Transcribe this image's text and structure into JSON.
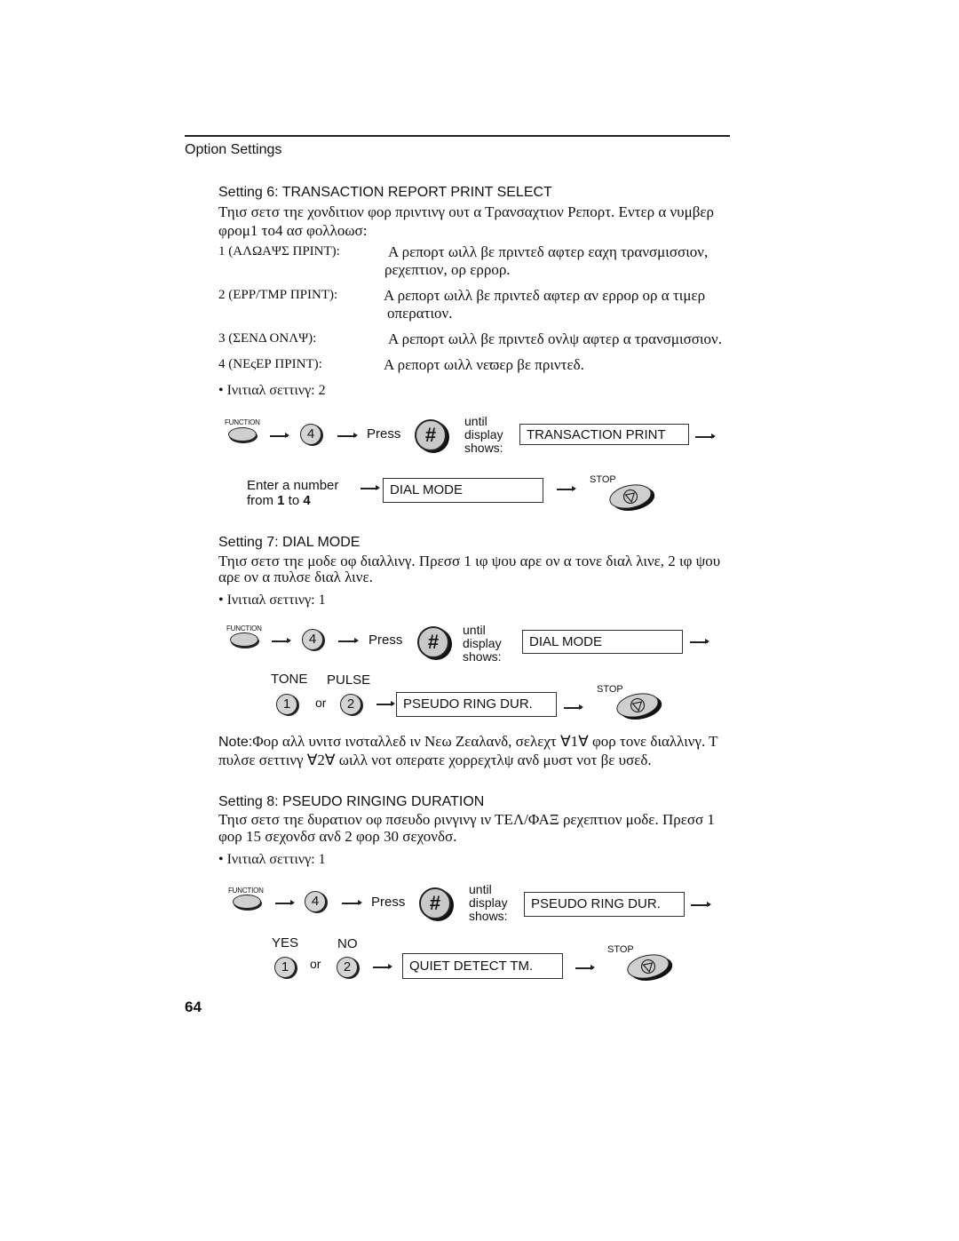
{
  "header": {
    "title": "Option Settings"
  },
  "page_number": "64",
  "setting6": {
    "heading": "Setting 6: TRANSACTION REPORT PRINT SELECT",
    "para_line1": "Τηισ σετσ τηε χονδιτιον φορ πριντινγ ουτ α Τρανσαχτιον Ρεπορτ. Εντερ α νυμβερ",
    "para_line2": "φρομ1 το4 ασ φολλοωσ:",
    "options": [
      {
        "key": "1 (ΑΛΩΑΨΣ ΠΡΙΝΤ):",
        "desc1": "Α ρεπορτ ωιλλ βε πριντεδ αφτερ εαχη τρανσμισσιον,",
        "desc2": "ρεχεπτιον, ορ ερρορ."
      },
      {
        "key": "2 (ΕΡΡ/ΤΜΡ ΠΡΙΝΤ):",
        "desc1": "Α ρεπορτ ωιλλ βε πριντεδ αφτερ αν ερρορ ορ α τιμερ",
        "desc2": "οπερατιον."
      },
      {
        "key": "3 (ΣΕΝΔ ΟΝΛΨ):",
        "desc1": "Α ρεπορτ ωιλλ βε πριντεδ ονλψ αφτερ α τρανσμισσιον.",
        "desc2": ""
      },
      {
        "key": "4 (ΝΕςΕΡ ΠΡΙΝΤ):",
        "desc1": "Α ρεπορτ ωιλλ νεϖερ βε πριντεδ.",
        "desc2": ""
      }
    ],
    "initial_setting": "• Ινιτιαλ σεττινγ: 2",
    "diagram": {
      "function_label": "FUNCTION",
      "key": "4",
      "press": "Press",
      "hash": "#",
      "until": "until",
      "display_word": "display",
      "shows": "shows:",
      "display1": "TRANSACTION PRINT",
      "enter_line1": "Enter a number",
      "enter_from": "from ",
      "enter_1": "1",
      "enter_to": " to ",
      "enter_4": "4",
      "display2": "DIAL MODE",
      "stop_label": "STOP"
    }
  },
  "setting7": {
    "heading": "Setting 7: DIAL MODE",
    "para_line1": "Τηισ σετσ τηε μοδε οφ διαλλινγ. Πρεσσ 1 ιφ ψου αρε ον α τονε διαλ λινε, 2 ιφ ψου",
    "para_line2": "αρε ον α πυλσε διαλ λινε.",
    "initial_setting": "• Ινιτιαλ σεττινγ: 1",
    "diagram": {
      "function_label": "FUNCTION",
      "key": "4",
      "press": "Press",
      "hash": "#",
      "until": "until",
      "display_word": "display",
      "shows": "shows:",
      "display1": "DIAL MODE",
      "opt1_label": "TONE",
      "opt2_label": "PULSE",
      "opt1_key": "1",
      "or": "or",
      "opt2_key": "2",
      "display2": "PSEUDO RING DUR.",
      "stop_label": "STOP"
    },
    "note_label": "Note:",
    "note_line1": "Φορ αλλ υνιτσ ινσταλλεδ ιν Νεω Ζεαλανδ, σελεχτ ∀1∀ φορ τονε διαλλινγ. Τ",
    "note_line2": "πυλσε σεττινγ ∀2∀ ωιλλ νοτ οπερατε χορρεχτλψ ανδ μυστ νοτ βε υσεδ."
  },
  "setting8": {
    "heading": "Setting 8: PSEUDO RINGING DURATION",
    "para_line1": "Τηισ σετσ τηε δυρατιον οφ πσευδο ρινγινγ ιν ΤΕΛ/ΦΑΞ ρεχεπτιον μοδε. Πρεσσ 1",
    "para_line2": "φορ 15 σεχονδσ ανδ 2 φορ 30 σεχονδσ.",
    "initial_setting": "• Ινιτιαλ σεττινγ: 1",
    "diagram": {
      "function_label": "FUNCTION",
      "key": "4",
      "press": "Press",
      "hash": "#",
      "until": "until",
      "display_word": "display",
      "shows": "shows:",
      "display1": "PSEUDO RING DUR.",
      "opt1_label": "YES",
      "opt2_label": "NO",
      "opt1_key": "1",
      "or": "or",
      "opt2_key": "2",
      "display2": "QUIET DETECT TM.",
      "stop_label": "STOP"
    }
  }
}
